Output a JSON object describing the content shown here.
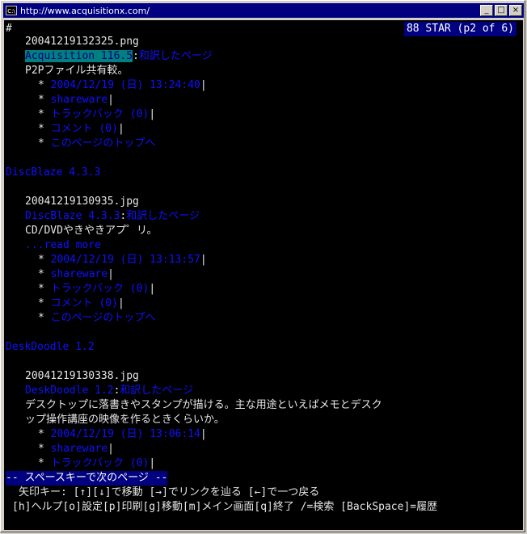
{
  "window": {
    "title": "http://www.acquisitionx.com/",
    "icon_text": "C:\\",
    "buttons": {
      "minimize": "_",
      "maximize": "□",
      "close": "×"
    }
  },
  "console": {
    "hash": "#",
    "status_right": "88 STAR (p2 of 6)",
    "entries": [
      {
        "filename": "20041219132325.png",
        "title_link": "Acquisition 116.5",
        "translated_link": "和訳したページ",
        "description": "P2Pファイル共有較。",
        "meta": [
          "2004/12/19 (日) 13:24:40",
          "shareware",
          "トラックバック (0)",
          "コメント (0)",
          "このページのトップへ"
        ]
      },
      {
        "heading": "DiscBlaze 4.3.3",
        "filename": "20041219130935.jpg",
        "title_link": "DiscBlaze 4.3.3",
        "translated_link": "和訳したページ",
        "description": "CD/DVDやきやきアプ゜リ。",
        "read_more": "...read more",
        "meta": [
          "2004/12/19 (日) 13:13:57",
          "shareware",
          "トラックバック (0)",
          "コメント (0)",
          "このページのトップへ"
        ]
      },
      {
        "heading": "DeskDoodle 1.2",
        "filename": "20041219130338.jpg",
        "title_link": "DeskDoodle 1.2",
        "translated_link": "和訳したページ",
        "description_1": "デスクトップに落書きやスタンプが描ける。主な用途といえばメモとデスク",
        "description_2": "ップ操作講座の映像を作るときくらいか。",
        "meta": [
          "2004/12/19 (日) 13:06:14",
          "shareware",
          "トラックバック (0)"
        ]
      }
    ],
    "separator": ":",
    "bullet": "*",
    "pager": "-- スペースキーで次のページ --",
    "help_line_1": "矢印キー: [↑][↓]で移動 [→]でリンクを辿る [←]で一つ戻る",
    "help_line_2": "[h]ヘルプ[o]設定[p]印刷[g]移動[m]メイン画面[q]終了 /=検索 [BackSpace]=履歴"
  }
}
